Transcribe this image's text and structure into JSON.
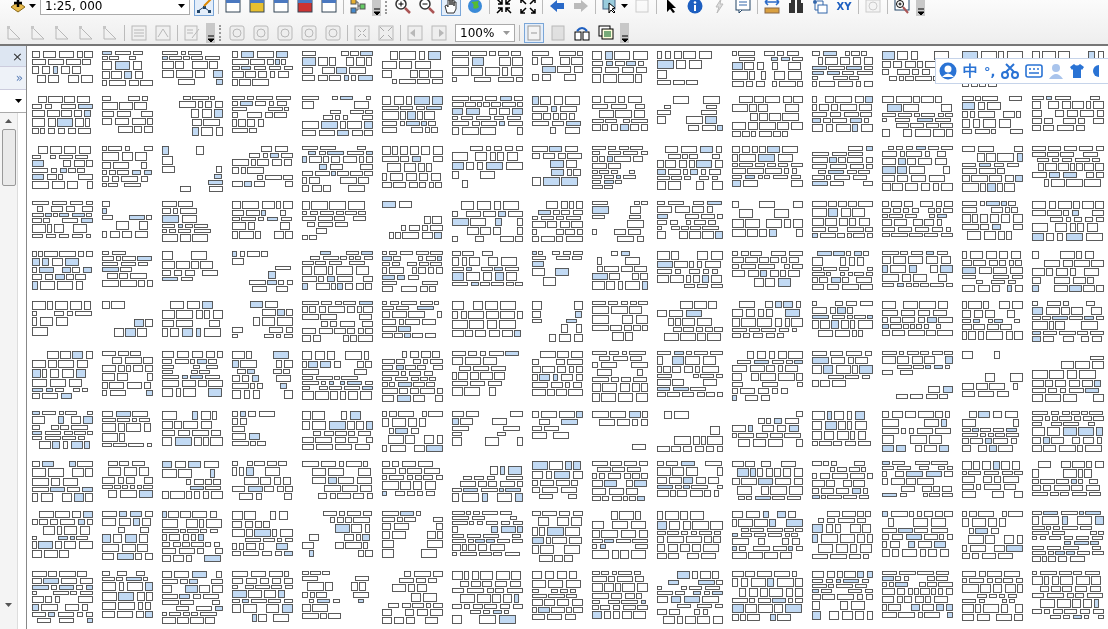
{
  "toolbar": {
    "scale": "1:25, 000",
    "zoom_percent": "100%",
    "xy_label": "XY"
  },
  "side_panel": {
    "close": "×",
    "expand": "»"
  },
  "ime_bar": {
    "language": "中",
    "punctuation": "°,"
  }
}
